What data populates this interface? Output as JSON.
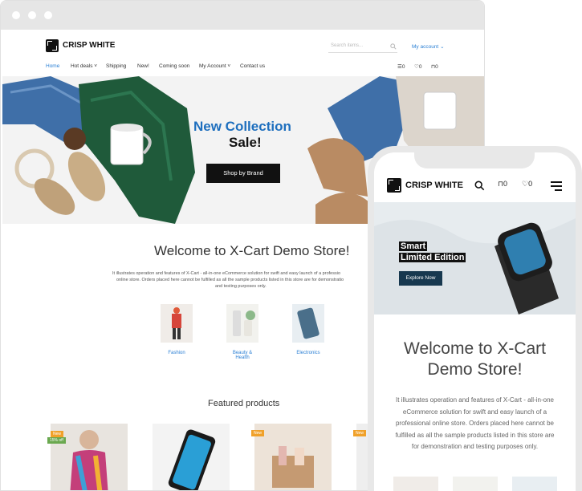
{
  "desktop": {
    "brand": "CRISP WHITE",
    "search_placeholder": "Search items...",
    "account": "My account",
    "nav": [
      "Home",
      "Hot deals",
      "Shipping",
      "New!",
      "Coming soon",
      "My Account",
      "Contact us"
    ],
    "cart_counts": {
      "compare": "0",
      "wishlist": "0",
      "bag": "0"
    },
    "hero": {
      "title": "New Collection",
      "subtitle": "Sale!",
      "button": "Shop by Brand"
    },
    "welcome": "Welcome to X-Cart Demo Store!",
    "intro_lines": [
      "It illustrates operation and features of X-Cart - all-in-one eCommerce solution for swift and easy launch of a professio",
      "online store. Orders placed here cannot be fulfilled as all the sample products listed in this store are for demonstratio",
      "and testing purposes only."
    ],
    "categories": [
      {
        "label": "Fashion"
      },
      {
        "label_line1": "Beauty &",
        "label_line2": "Health"
      },
      {
        "label": "Electronics"
      }
    ],
    "featured": "Featured products",
    "product_tags": {
      "p1_new": "New",
      "p1_off": "15% off",
      "p3_new": "New",
      "p4_new": "New"
    }
  },
  "mobile": {
    "brand": "CRISP WHITE",
    "counts": {
      "bag": "0",
      "wishlist": "0"
    },
    "hero": {
      "line1": "Smart",
      "line2": "Limited Edition",
      "button": "Explore Now"
    },
    "welcome_line1": "Welcome to X-Cart",
    "welcome_line2": "Demo Store!",
    "text_lines": [
      "It illustrates operation and features of X-Cart - all-in-one",
      "eCommerce solution for swift and easy launch of a",
      "professional online store. Orders placed here cannot be",
      "fulfilled as all the sample products listed in this store are",
      "for demonstration and testing purposes only."
    ]
  }
}
